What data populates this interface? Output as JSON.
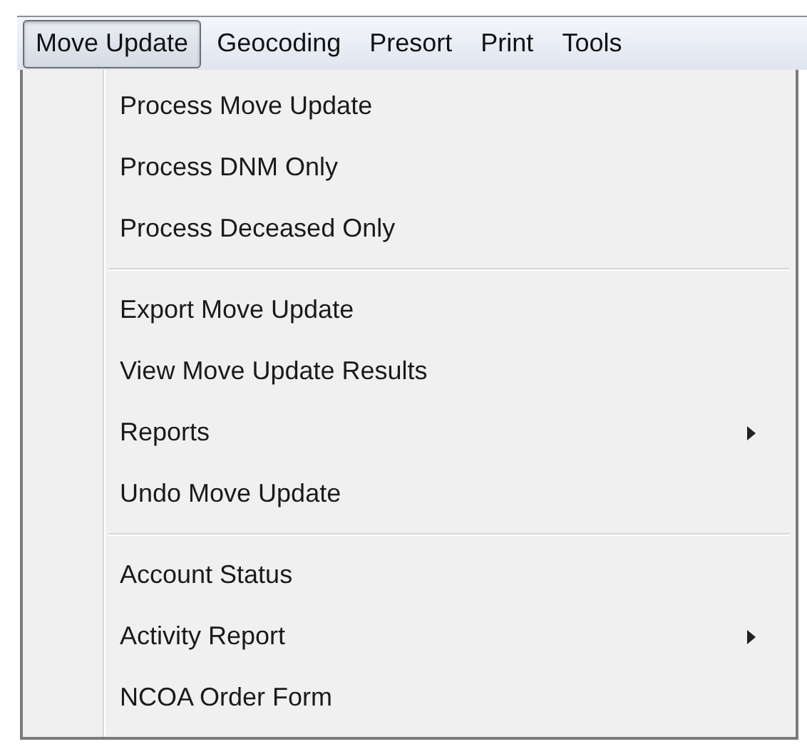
{
  "menubar": [
    {
      "label": "Move Update",
      "selected": true
    },
    {
      "label": "Geocoding",
      "selected": false
    },
    {
      "label": "Presort",
      "selected": false
    },
    {
      "label": "Print",
      "selected": false
    },
    {
      "label": "Tools",
      "selected": false
    }
  ],
  "menu": {
    "groups": [
      [
        {
          "label": "Process Move Update",
          "submenu": false
        },
        {
          "label": "Process DNM Only",
          "submenu": false
        },
        {
          "label": "Process Deceased Only",
          "submenu": false
        }
      ],
      [
        {
          "label": "Export Move Update",
          "submenu": false
        },
        {
          "label": "View Move Update Results",
          "submenu": false
        },
        {
          "label": "Reports",
          "submenu": true
        },
        {
          "label": "Undo Move Update",
          "submenu": false
        }
      ],
      [
        {
          "label": "Account Status",
          "submenu": false
        },
        {
          "label": "Activity Report",
          "submenu": true
        },
        {
          "label": "NCOA Order Form",
          "submenu": false
        }
      ]
    ]
  }
}
